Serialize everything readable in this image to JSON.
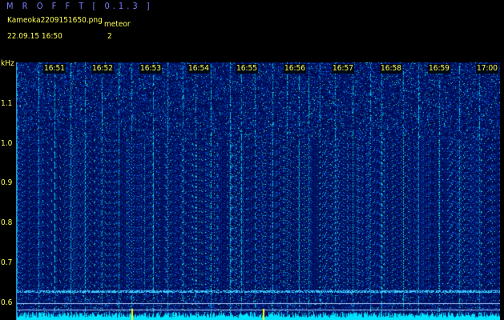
{
  "app": {
    "title": "M R O F F T [ 0.1.3 ]"
  },
  "file": {
    "name": "Kameoka2209151650.png"
  },
  "meteor": {
    "label": "meteor",
    "count": "2"
  },
  "timestamp": "22.09.15 16:50",
  "axis": {
    "unit": "kHz",
    "freq_ticks": [
      "1.1",
      "1.0",
      "0.9",
      "0.8",
      "0.7",
      "0.6"
    ]
  },
  "time_markers": [
    "16:51",
    "16:52",
    "16:53",
    "16:54",
    "16:55",
    "16:56",
    "16:57",
    "16:58",
    "16:59",
    "17:00"
  ],
  "colors": {
    "background": "#000000",
    "text": "#ffff55",
    "title": "#7b7bff",
    "spectrogram_bg": "#00104a",
    "noise_floor": "#00e5ff",
    "marker": "#ffff00"
  }
}
